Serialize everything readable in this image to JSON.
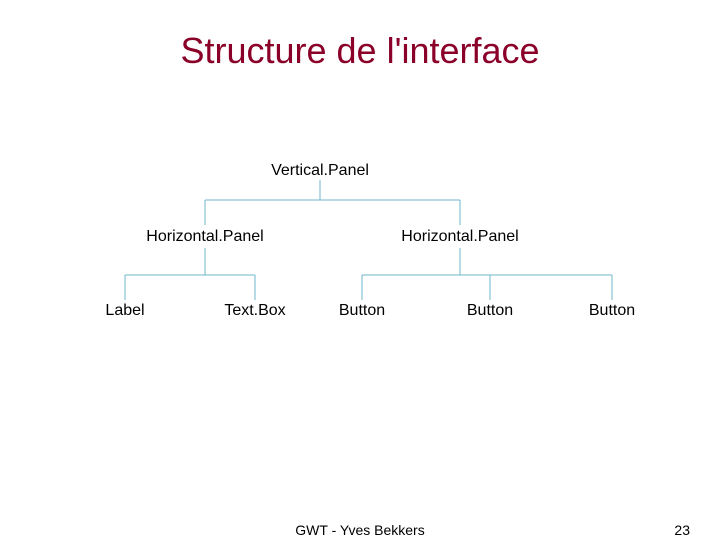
{
  "title": "Structure de l'interface",
  "nodes": {
    "root": "Vertical.Panel",
    "hpanel_left": "Horizontal.Panel",
    "hpanel_right": "Horizontal.Panel",
    "label": "Label",
    "textbox": "Text.Box",
    "button1": "Button",
    "button2": "Button",
    "button3": "Button"
  },
  "footer": {
    "author": "GWT - Yves Bekkers",
    "page": "23"
  }
}
